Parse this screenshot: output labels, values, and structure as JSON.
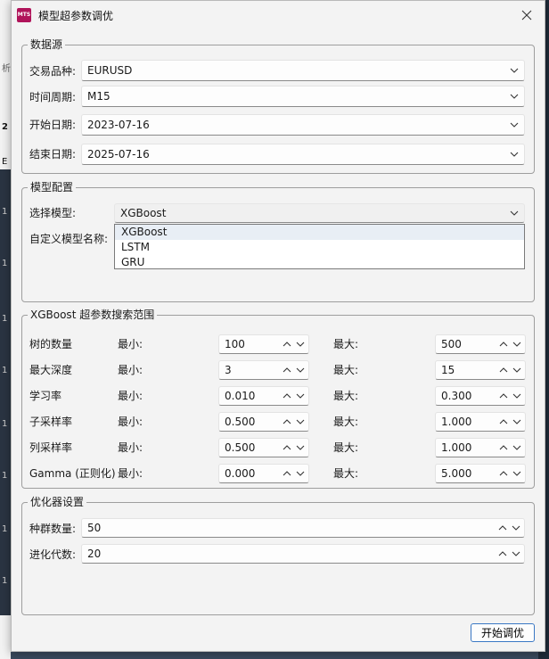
{
  "window": {
    "title": "模型超参数调优",
    "icon_text": "MTS"
  },
  "data_source": {
    "title": "数据源",
    "rows": [
      {
        "label": "交易品种:",
        "value": "EURUSD"
      },
      {
        "label": "时间周期:",
        "value": "M15"
      },
      {
        "label": "开始日期:",
        "value": "2023-07-16"
      },
      {
        "label": "结束日期:",
        "value": "2025-07-16"
      }
    ]
  },
  "model_config": {
    "title": "模型配置",
    "select_label": "选择模型:",
    "selected_model": "XGBoost",
    "custom_name_label": "自定义模型名称:",
    "options": [
      "XGBoost",
      "LSTM",
      "GRU"
    ]
  },
  "hyper_range": {
    "title": "XGBoost 超参数搜索范围",
    "min_label": "最小:",
    "max_label": "最大:",
    "params": [
      {
        "name": "树的数量",
        "min": "100",
        "max": "500"
      },
      {
        "name": "最大深度",
        "min": "3",
        "max": "15"
      },
      {
        "name": "学习率",
        "min": "0.010",
        "max": "0.300"
      },
      {
        "name": "子采样率",
        "min": "0.500",
        "max": "1.000"
      },
      {
        "name": "列采样率",
        "min": "0.500",
        "max": "1.000"
      },
      {
        "name": "Gamma (正则化)",
        "min": "0.000",
        "max": "5.000"
      }
    ]
  },
  "optimizer": {
    "title": "优化器设置",
    "population_label": "种群数量:",
    "population_value": "50",
    "generations_label": "进化代数:",
    "generations_value": "20"
  },
  "actions": {
    "start_label": "开始调优"
  },
  "background": {
    "ticks": [
      "析",
      "2",
      "E",
      "1",
      "1",
      "1",
      "1",
      "1",
      "1",
      "1",
      "1"
    ]
  }
}
